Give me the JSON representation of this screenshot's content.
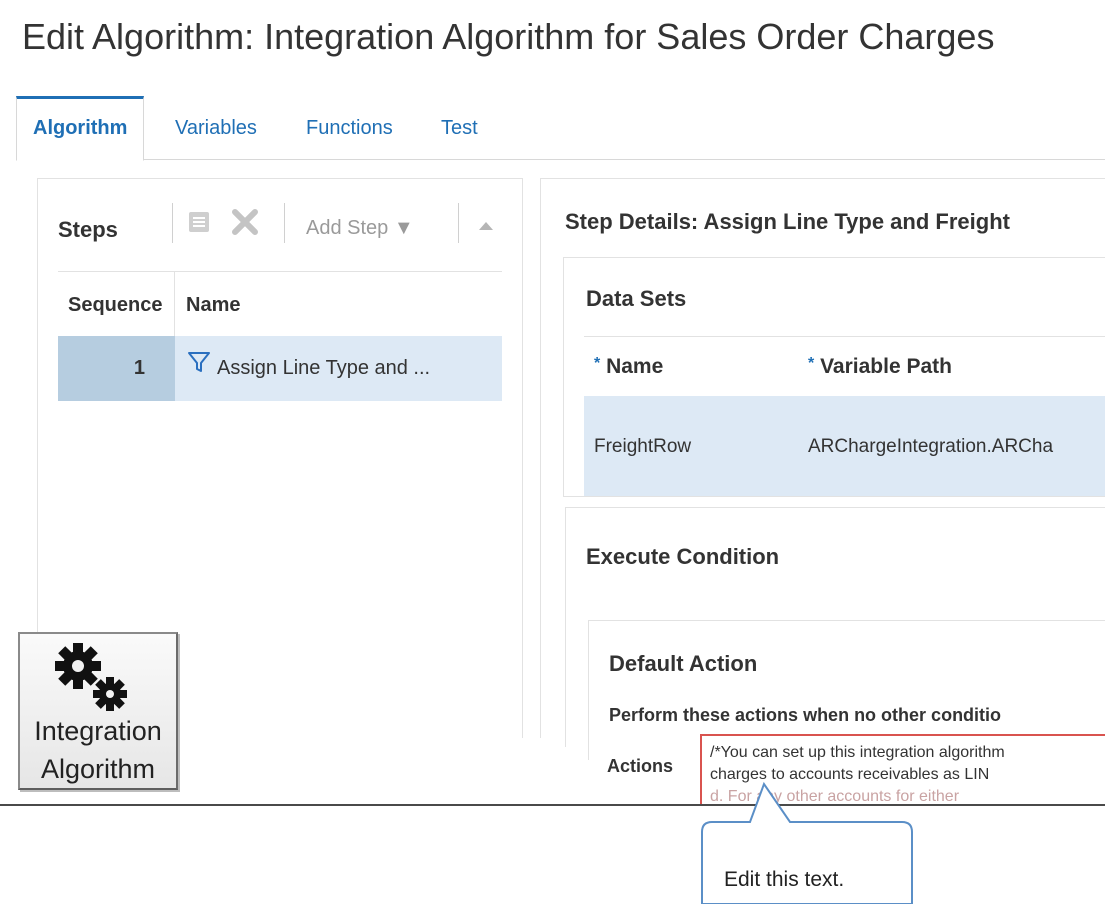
{
  "page": {
    "title": "Edit Algorithm: Integration Algorithm for Sales Order Charges"
  },
  "tabs": [
    {
      "label": "Algorithm",
      "active": true
    },
    {
      "label": "Variables",
      "active": false
    },
    {
      "label": "Functions",
      "active": false
    },
    {
      "label": "Test",
      "active": false
    }
  ],
  "steps_panel": {
    "title": "Steps",
    "toolbar": {
      "add_step_label": "Add Step ▼",
      "icons": [
        "detail-icon",
        "delete-icon",
        "move-up-icon"
      ]
    },
    "columns": {
      "sequence": "Sequence",
      "name": "Name"
    },
    "rows": [
      {
        "sequence": "1",
        "name": "Assign Line Type and ..."
      }
    ]
  },
  "details_panel": {
    "title": "Step Details: Assign Line Type and Freight",
    "data_sets": {
      "title": "Data Sets",
      "required_marker": "*",
      "columns": {
        "name": "Name",
        "variable_path": "Variable Path"
      },
      "rows": [
        {
          "name": "FreightRow",
          "variable_path": "ARChargeIntegration.ARCha"
        }
      ]
    },
    "execute_condition": {
      "title": "Execute Condition"
    },
    "default_action": {
      "title": "Default Action",
      "perform_text": "Perform these actions when no other conditio",
      "actions_label": "Actions",
      "actions_lines": [
        "/*You can set up this integration algorithm",
        "charges to accounts receivables as LIN",
        "d. For any other accounts for either"
      ]
    }
  },
  "badge": {
    "line1": "Integration",
    "line2": "Algorithm",
    "icon": "gears-icon"
  },
  "callout": {
    "text": "Edit this text."
  },
  "colors": {
    "accent": "#1f6fb5",
    "selected_row": "#dde9f5",
    "selected_seq": "#b6cde0",
    "highlight_border": "#d9534f",
    "callout_border": "#5b8fc7"
  }
}
